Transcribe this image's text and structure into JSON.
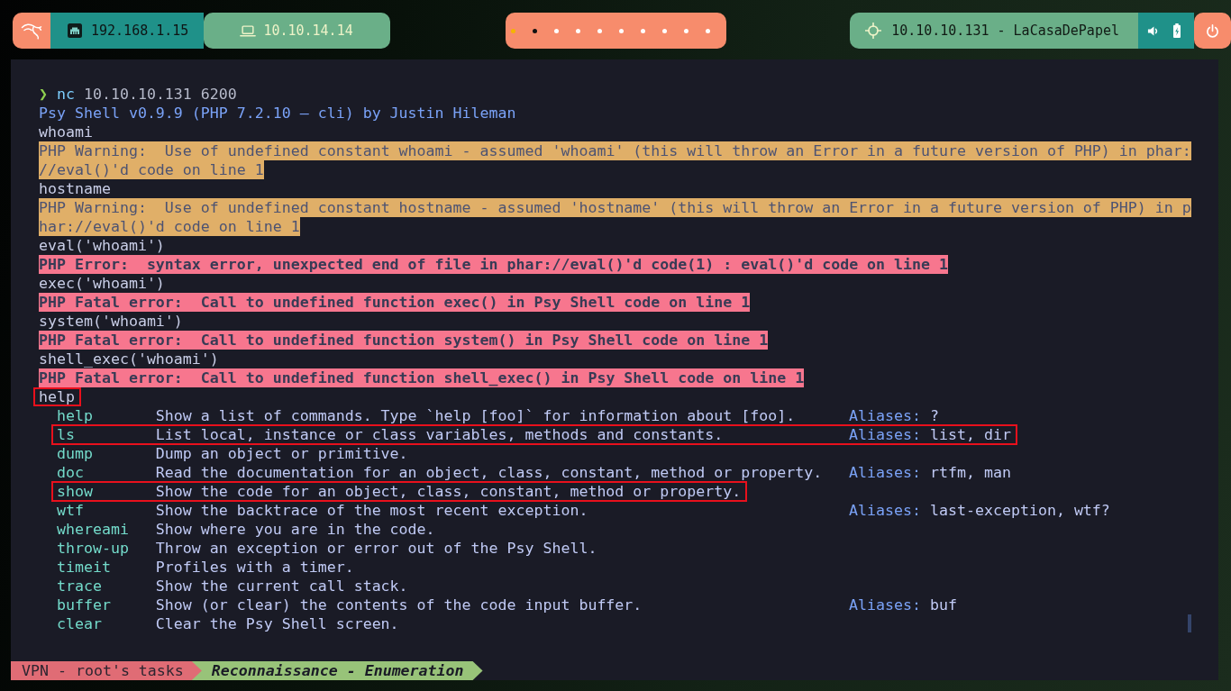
{
  "top_bar": {
    "ethernet_ip": "192.168.1.15",
    "vpn_ip": "10.10.14.14",
    "workspaces": [
      {
        "selected": true,
        "occupied": false
      },
      {
        "selected": false,
        "occupied": true
      },
      {
        "selected": false,
        "occupied": false
      },
      {
        "selected": false,
        "occupied": false
      },
      {
        "selected": false,
        "occupied": false
      },
      {
        "selected": false,
        "occupied": false
      },
      {
        "selected": false,
        "occupied": false
      },
      {
        "selected": false,
        "occupied": false
      },
      {
        "selected": false,
        "occupied": false
      },
      {
        "selected": false,
        "occupied": false
      }
    ],
    "target": "10.10.10.131 - LaCasaDePapel"
  },
  "terminal": {
    "prompt": {
      "symbol": "❯",
      "command": "nc",
      "arguments": "10.10.10.131 6200"
    },
    "banner": "Psy Shell v0.9.9 (PHP 7.2.10 — cli) by Justin Hileman",
    "output": [
      {
        "kind": "input",
        "text": "whoami",
        "highlighted": false
      },
      {
        "kind": "warning",
        "text": "PHP Warning:  Use of undefined constant whoami - assumed 'whoami' (this will throw an Error in a future version of PHP) in phar://eval()'d code on line 1",
        "highlighted": false
      },
      {
        "kind": "input",
        "text": "hostname",
        "highlighted": false
      },
      {
        "kind": "warning",
        "text": "PHP Warning:  Use of undefined constant hostname - assumed 'hostname' (this will throw an Error in a future version of PHP) in phar://eval()'d code on line 1",
        "highlighted": false
      },
      {
        "kind": "input",
        "text": "eval('whoami')",
        "highlighted": false
      },
      {
        "kind": "error",
        "text": "PHP Error:  syntax error, unexpected end of file in phar://eval()'d code(1) : eval()'d code on line 1",
        "highlighted": false
      },
      {
        "kind": "input",
        "text": "exec('whoami')",
        "highlighted": false
      },
      {
        "kind": "error",
        "text": "PHP Fatal error:  Call to undefined function exec() in Psy Shell code on line 1",
        "highlighted": false
      },
      {
        "kind": "input",
        "text": "system('whoami')",
        "highlighted": false
      },
      {
        "kind": "error",
        "text": "PHP Fatal error:  Call to undefined function system() in Psy Shell code on line 1",
        "highlighted": false
      },
      {
        "kind": "input",
        "text": "shell_exec('whoami')",
        "highlighted": false
      },
      {
        "kind": "error",
        "text": "PHP Fatal error:  Call to undefined function shell_exec() in Psy Shell code on line 1",
        "highlighted": false
      },
      {
        "kind": "input",
        "text": "help",
        "highlighted": true
      }
    ],
    "help_table": [
      {
        "command": "help",
        "description": "Show a list of commands. Type `help [foo]` for information about [foo].",
        "aliases": {
          "label": "Aliases:",
          "value": "?"
        },
        "highlighted": false
      },
      {
        "command": "ls",
        "description": "List local, instance or class variables, methods and constants.",
        "aliases": {
          "label": "Aliases:",
          "value": "list, dir"
        },
        "highlighted": true
      },
      {
        "command": "dump",
        "description": "Dump an object or primitive.",
        "highlighted": false
      },
      {
        "command": "doc",
        "description": "Read the documentation for an object, class, constant, method or property.",
        "aliases": {
          "label": "Aliases:",
          "value": "rtfm, man"
        },
        "highlighted": false
      },
      {
        "command": "show",
        "description": "Show the code for an object, class, constant, method or property.",
        "highlighted": true
      },
      {
        "command": "wtf",
        "description": "Show the backtrace of the most recent exception.",
        "aliases": {
          "label": "Aliases:",
          "value": "last-exception, wtf?"
        },
        "highlighted": false
      },
      {
        "command": "whereami",
        "description": "Show where you are in the code.",
        "highlighted": false
      },
      {
        "command": "throw-up",
        "description": "Throw an exception or error out of the Psy Shell.",
        "highlighted": false
      },
      {
        "command": "timeit",
        "description": "Profiles with a timer.",
        "highlighted": false
      },
      {
        "command": "trace",
        "description": "Show the current call stack.",
        "highlighted": false
      },
      {
        "command": "buffer",
        "description": "Show (or clear) the contents of the code input buffer.",
        "aliases": {
          "label": "Aliases:",
          "value": "buf"
        },
        "highlighted": false
      },
      {
        "command": "clear",
        "description": "Clear the Psy Shell screen.",
        "highlighted": false
      }
    ]
  },
  "status_bar": {
    "session": "VPN - root's tasks",
    "windows": [
      {
        "name": "Reconnaissance - Enumeration",
        "selected": true
      }
    ]
  }
}
